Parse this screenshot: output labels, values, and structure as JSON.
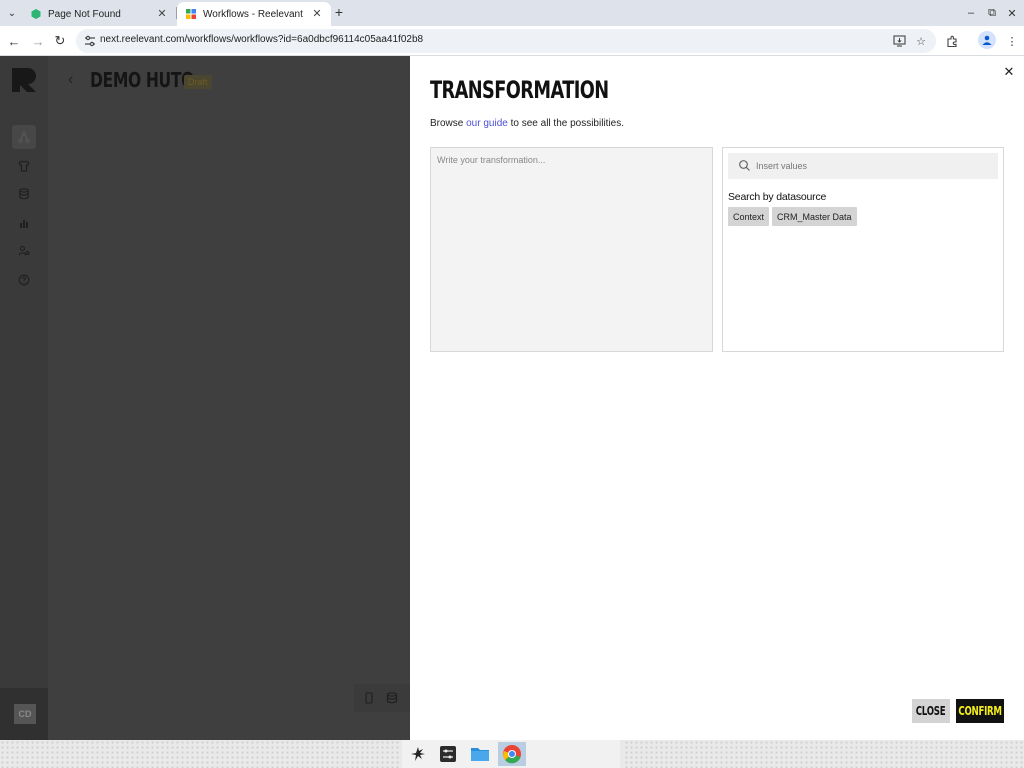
{
  "browser": {
    "tabs": [
      {
        "title": "Page Not Found",
        "active": false
      },
      {
        "title": "Workflows - Reelevant",
        "active": true
      }
    ],
    "url": "next.reelevant.com/workflows/workflows?id=6a0dbcf96114c05aa41f02b8"
  },
  "app": {
    "sidebar_icons": [
      "workflow-icon",
      "shirt-icon",
      "database-icon",
      "bar-chart-icon",
      "user-settings-icon",
      "help-icon"
    ],
    "workflow_title": "DEMO HUTO",
    "status_badge": "Draft",
    "user_initials": "CD"
  },
  "modal": {
    "title": "TRANSFORMATION",
    "browse_prefix": "Browse ",
    "browse_link": "our guide",
    "browse_suffix": " to see all the possibilities.",
    "editor_placeholder": "Write your transformation...",
    "search_placeholder": "Insert values",
    "datasource_label": "Search by datasource",
    "datasources": [
      "Context",
      "CRM_Master Data"
    ],
    "close_label": "CLOSE",
    "confirm_label": "CONFIRM"
  },
  "colors": {
    "confirm_bg": "#111111",
    "confirm_text": "#f4ee1a",
    "link": "#4c4fd6",
    "backdrop": "#3f3f3f"
  }
}
